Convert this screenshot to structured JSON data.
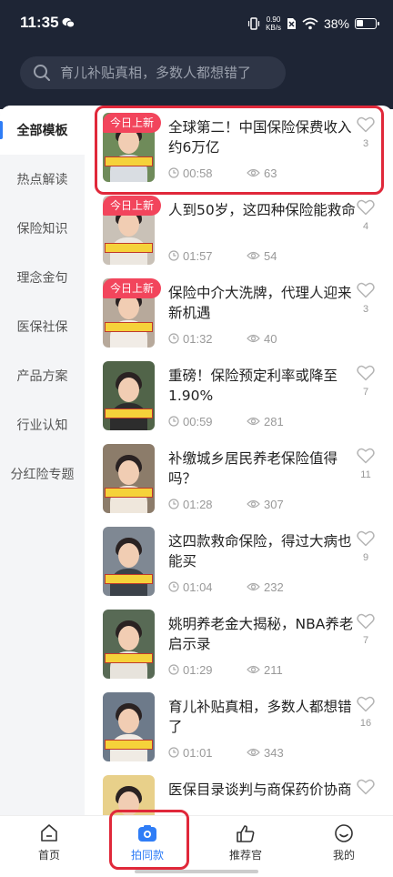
{
  "status_bar": {
    "time": "11:35",
    "net_speed_value": "0.90",
    "net_speed_unit": "KB/s",
    "battery_text": "38%",
    "battery_level": 0.38
  },
  "search": {
    "placeholder": "育儿补贴真相，多数人都想错了"
  },
  "sidebar": {
    "items": [
      {
        "label": "全部模板",
        "active": true
      },
      {
        "label": "热点解读"
      },
      {
        "label": "保险知识"
      },
      {
        "label": "理念金句"
      },
      {
        "label": "医保社保"
      },
      {
        "label": "产品方案"
      },
      {
        "label": "行业认知"
      },
      {
        "label": "分红险专题"
      }
    ]
  },
  "feed": {
    "items": [
      {
        "badge": "今日上新",
        "title": "全球第二！中国保险保费收入约6万亿",
        "duration": "00:58",
        "views": "63",
        "likes": "3",
        "thumb_caption": "保费收入约6万亿"
      },
      {
        "badge": "今日上新",
        "title": "人到50岁，这四种保险能救命",
        "duration": "01:57",
        "views": "54",
        "likes": "4",
        "thumb_caption": "这四种保险能救命"
      },
      {
        "badge": "今日上新",
        "title": "保险中介大洗牌，代理人迎来新机遇",
        "duration": "01:32",
        "views": "40",
        "likes": "3",
        "thumb_caption": "保险中介大洗牌"
      },
      {
        "badge": "",
        "title": "重磅！保险预定利率或降至1.90%",
        "duration": "00:59",
        "views": "281",
        "likes": "7",
        "thumb_caption": "重磅：保险预定利率"
      },
      {
        "badge": "",
        "title": "补缴城乡居民养老保险值得吗？",
        "duration": "01:28",
        "views": "307",
        "likes": "11",
        "thumb_caption": "补缴城乡居民养老"
      },
      {
        "badge": "",
        "title": "这四款救命保险，得过大病也能买",
        "duration": "01:04",
        "views": "232",
        "likes": "9",
        "thumb_caption": "得过大病也能买"
      },
      {
        "badge": "",
        "title": "姚明养老金大揭秘，NBA养老启示录",
        "duration": "01:29",
        "views": "211",
        "likes": "7",
        "thumb_caption": "姚明养老金大揭秘"
      },
      {
        "badge": "",
        "title": "育儿补贴真相，多数人都想错了",
        "duration": "01:01",
        "views": "343",
        "likes": "16",
        "thumb_caption": "育儿补贴真相"
      },
      {
        "badge": "",
        "title": "医保目录谈判与商保药价协商",
        "duration": "",
        "views": "",
        "likes": "",
        "thumb_caption": ""
      }
    ]
  },
  "bottom_nav": {
    "items": [
      {
        "label": "首页",
        "icon": "home-icon"
      },
      {
        "label": "拍同款",
        "icon": "camera-icon",
        "active": true
      },
      {
        "label": "推荐官",
        "icon": "thumbs-up-icon"
      },
      {
        "label": "我的",
        "icon": "smile-icon"
      }
    ]
  },
  "colors": {
    "accent": "#2f7df6",
    "badge": "#f2455c",
    "highlight": "#e0283a",
    "header_bg": "#1e2535"
  }
}
